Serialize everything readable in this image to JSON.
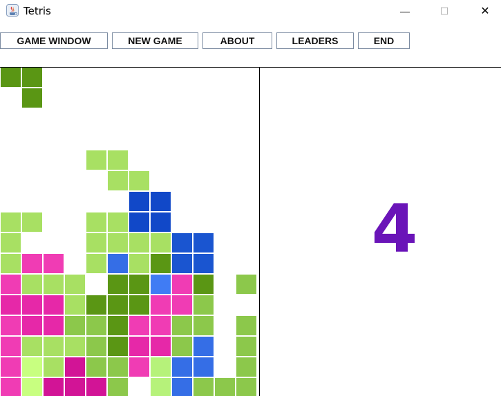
{
  "window": {
    "title": "Tetris",
    "controls": {
      "minimize": "—",
      "maximize": "☐",
      "close": "✕"
    }
  },
  "menu": {
    "buttons": [
      {
        "id": "game-window",
        "label": "GAME WINDOW"
      },
      {
        "id": "new-game",
        "label": "NEW GAME"
      },
      {
        "id": "about",
        "label": "ABOUT"
      },
      {
        "id": "leaders",
        "label": "LEADERS"
      },
      {
        "id": "end",
        "label": "END"
      }
    ]
  },
  "colors": {
    "D": "#5a9614",
    "L": "#a8e063",
    "G": "#8cc84b",
    "K": "#1148c8",
    "B": "#1a55d0",
    "R": "#356ee6",
    "S": "#407cf4",
    "P": "#f03cb4",
    "M": "#e628a8",
    "C": "#d21496",
    "Y": "#c8ff80",
    "H": "#b6f27a"
  },
  "board": {
    "rows": [
      "DD..........",
      ".D..........",
      "............",
      "............",
      "....LL......",
      ".....LL.....",
      "......KK....",
      "LL..LLKK....",
      "L...LLLLBB..",
      "LPP.LRLDBB..",
      "PLLL.DDSPD.G",
      "MMMLDDDPPG..",
      "PMMGGDPPGG.G",
      "PLLLGDMMGR.G",
      "PYLCGGPHRR.G",
      "PYCCCG.HRGGG"
    ]
  },
  "next_piece": {
    "value": "4"
  }
}
